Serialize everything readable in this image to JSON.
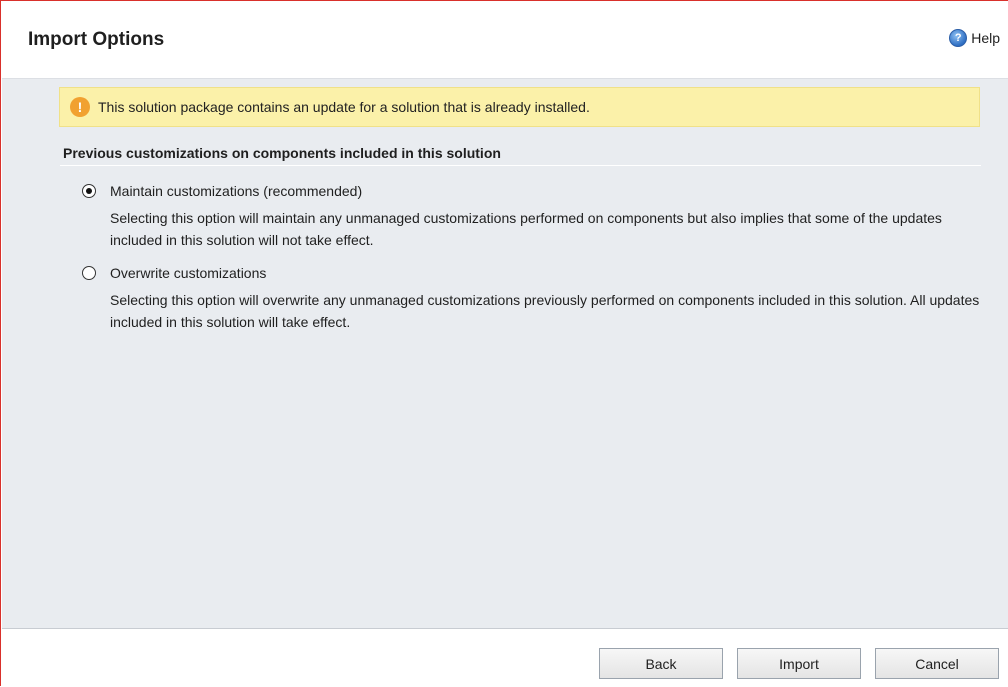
{
  "dialog": {
    "title": "Import Options",
    "help_label": "Help"
  },
  "warning": {
    "text": "This solution package contains an update for a solution that is already installed."
  },
  "section": {
    "title": "Previous customizations on components included in this solution"
  },
  "options": [
    {
      "label": "Maintain customizations (recommended)",
      "description": "Selecting this option will maintain any unmanaged customizations performed on components but also implies that some of the updates included in this solution will not take effect.",
      "selected": true
    },
    {
      "label": "Overwrite customizations",
      "description": "Selecting this option will overwrite any unmanaged customizations previously performed on components included in this solution. All updates included in this solution will take effect.",
      "selected": false
    }
  ],
  "buttons": {
    "back": "Back",
    "import": "Import",
    "cancel": "Cancel"
  },
  "colors": {
    "accent_border": "#d9302b",
    "warning_bg": "#fbf1a9",
    "body_bg": "#e9ecf0"
  }
}
